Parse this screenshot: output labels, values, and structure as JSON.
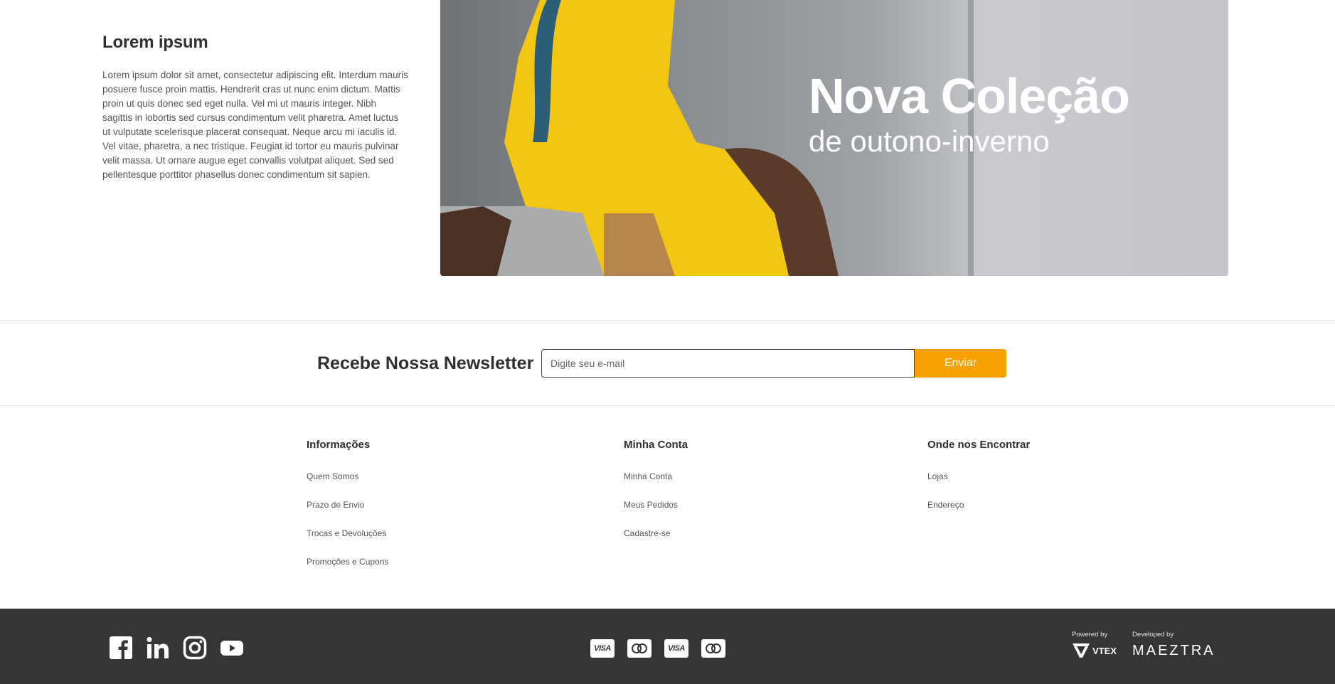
{
  "intro": {
    "title": "Lorem ipsum",
    "body": "Lorem ipsum dolor sit amet, consectetur adipiscing elit. Interdum mauris posuere fusce proin mattis. Hendrerit cras ut nunc enim dictum. Mattis proin ut quis donec sed eget nulla. Vel mi ut mauris integer. Nibh sagittis in lobortis sed cursus condimentum velit pharetra. Amet luctus ut vulputate scelerisque placerat consequat. Neque arcu mi iaculis id. Vel vitae, pharetra, a nec tristique. Feugiat id tortor eu mauris pulvinar velit massa. Ut ornare augue eget convallis volutpat aliquet. Sed sed pellentesque porttitor phasellus donec condimentum sit sapien."
  },
  "hero": {
    "title": "Nova Coleção",
    "subtitle": "de outono-inverno"
  },
  "newsletter": {
    "title": "Recebe Nossa Newsletter",
    "placeholder": "Digite seu e-mail",
    "button": "Enviar"
  },
  "footer": {
    "columns": [
      {
        "title": "Informações",
        "links": [
          "Quem Somos",
          "Prazo de Envio",
          "Trocas e Devoluções",
          "Promoções e Cupons"
        ]
      },
      {
        "title": "Minha Conta",
        "links": [
          "Minha Conta",
          "Meus Pedidos",
          "Cadastre-se"
        ]
      },
      {
        "title": "Onde nos Encontrar",
        "links": [
          "Lojas",
          "Endereço"
        ]
      }
    ]
  },
  "bottom": {
    "social_icons": [
      "facebook-icon",
      "linkedin-icon",
      "instagram-icon",
      "youtube-icon"
    ],
    "payments": [
      "VISA",
      "mastercard",
      "VISA",
      "mastercard"
    ],
    "powered_by_label": "Powered by",
    "powered_by_brand": "VTEX",
    "developed_by_label": "Developed by",
    "developed_by_brand": "MAEZTRA"
  },
  "colors": {
    "accent": "#f8a102",
    "bottom_bar": "#353535",
    "text_dark": "#2f2f2f"
  }
}
